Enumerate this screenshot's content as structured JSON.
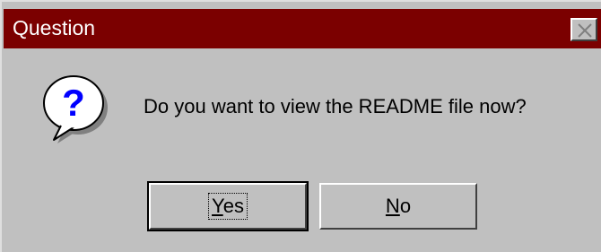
{
  "window": {
    "title": "Question"
  },
  "message": {
    "text": "Do you want to view the README file now?",
    "icon": "question-icon"
  },
  "buttons": {
    "yes": {
      "mnemonic": "Y",
      "rest": "es"
    },
    "no": {
      "mnemonic": "N",
      "rest": "o"
    }
  },
  "colors": {
    "titlebar": "#7b0000",
    "dialog_bg": "#c0c0c0",
    "icon_blue": "#0000ff"
  }
}
